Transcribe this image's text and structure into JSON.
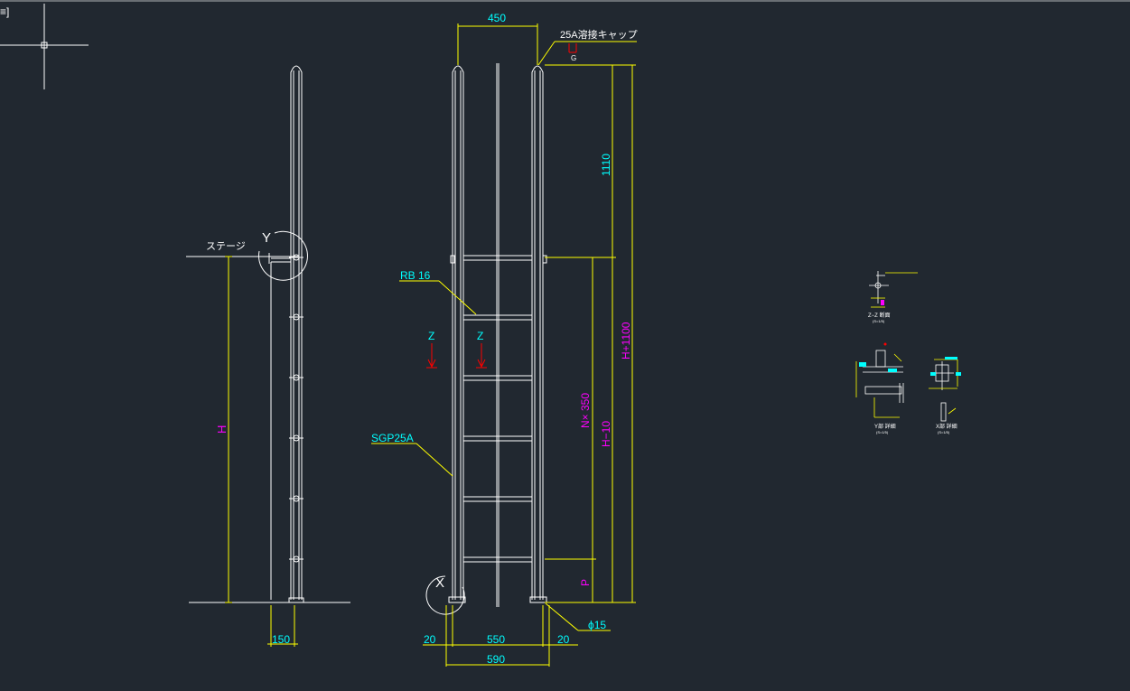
{
  "viewport": {
    "label": "≡]"
  },
  "colors": {
    "background": "#212830",
    "geometry": "#ffffff",
    "dimension": "#ffff00",
    "text_cyan": "#00ffff",
    "text_magenta": "#ff00ff",
    "section_marker": "#ff0000"
  },
  "side_view": {
    "stage_label": "ステージ",
    "detail_marker": "Y",
    "height_label": "H",
    "width_dim": "150"
  },
  "front_view": {
    "top_dim": "450",
    "cap_label": "25A溶接キャップ",
    "cap_sub": "G",
    "rung_label": "RB 16",
    "pipe_label": "SGP25A",
    "section_z_left": "Z",
    "section_z_right": "Z",
    "detail_marker": "X",
    "dim_1110": "1110",
    "dim_h1100": "H+1100",
    "dim_nx350": "N× 350",
    "dim_h10": "H−10",
    "dim_p": "P",
    "dim_hole": "ϕ15",
    "dim_left_20": "20",
    "dim_mid_550": "550",
    "dim_right_20": "20",
    "dim_total_590": "590"
  },
  "details": {
    "zz_title": "Z−Z 断面",
    "zz_scale": "(S=1/5)",
    "y_title": "Y部 詳細",
    "y_scale": "(S=1/5)",
    "x_title": "X部 詳細",
    "x_scale": "(S=1/5)"
  }
}
